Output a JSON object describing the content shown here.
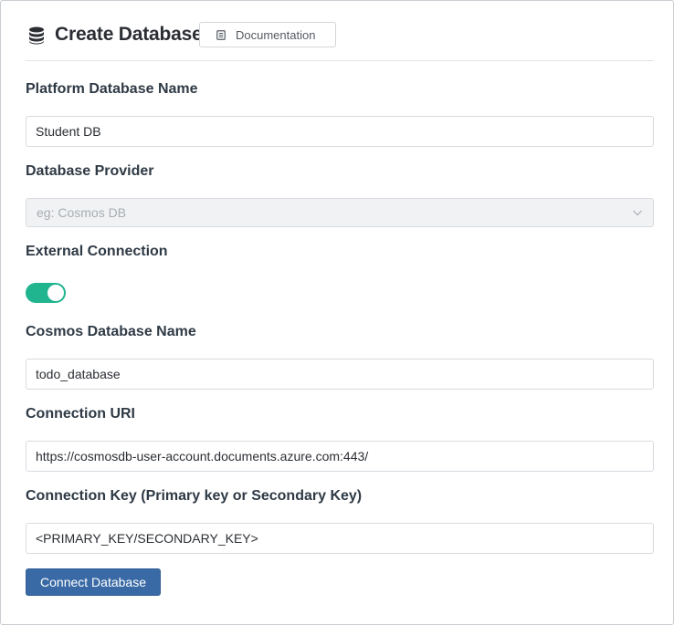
{
  "header": {
    "title": "Create Database",
    "title_icon": "database-icon",
    "documentation_label": "Documentation",
    "documentation_icon": "document-icon"
  },
  "form": {
    "platform_db_name": {
      "label": "Platform Database Name",
      "value": "Student DB"
    },
    "provider": {
      "label": "Database Provider",
      "placeholder": "eg: Cosmos DB",
      "icon": "chevron-down-icon"
    },
    "external_connection": {
      "label": "External Connection",
      "enabled": true,
      "color": "#20b48f"
    },
    "cosmos_db_name": {
      "label": "Cosmos Database Name",
      "value": "todo_database"
    },
    "connection_uri": {
      "label": "Connection URI",
      "value": "https://cosmosdb-user-account.documents.azure.com:443/"
    },
    "connection_key": {
      "label": "Connection Key (Primary key or Secondary Key)",
      "value": "<PRIMARY_KEY/SECONDARY_KEY>"
    },
    "submit_label": "Connect Database",
    "submit_color": "#3a6aa5"
  }
}
